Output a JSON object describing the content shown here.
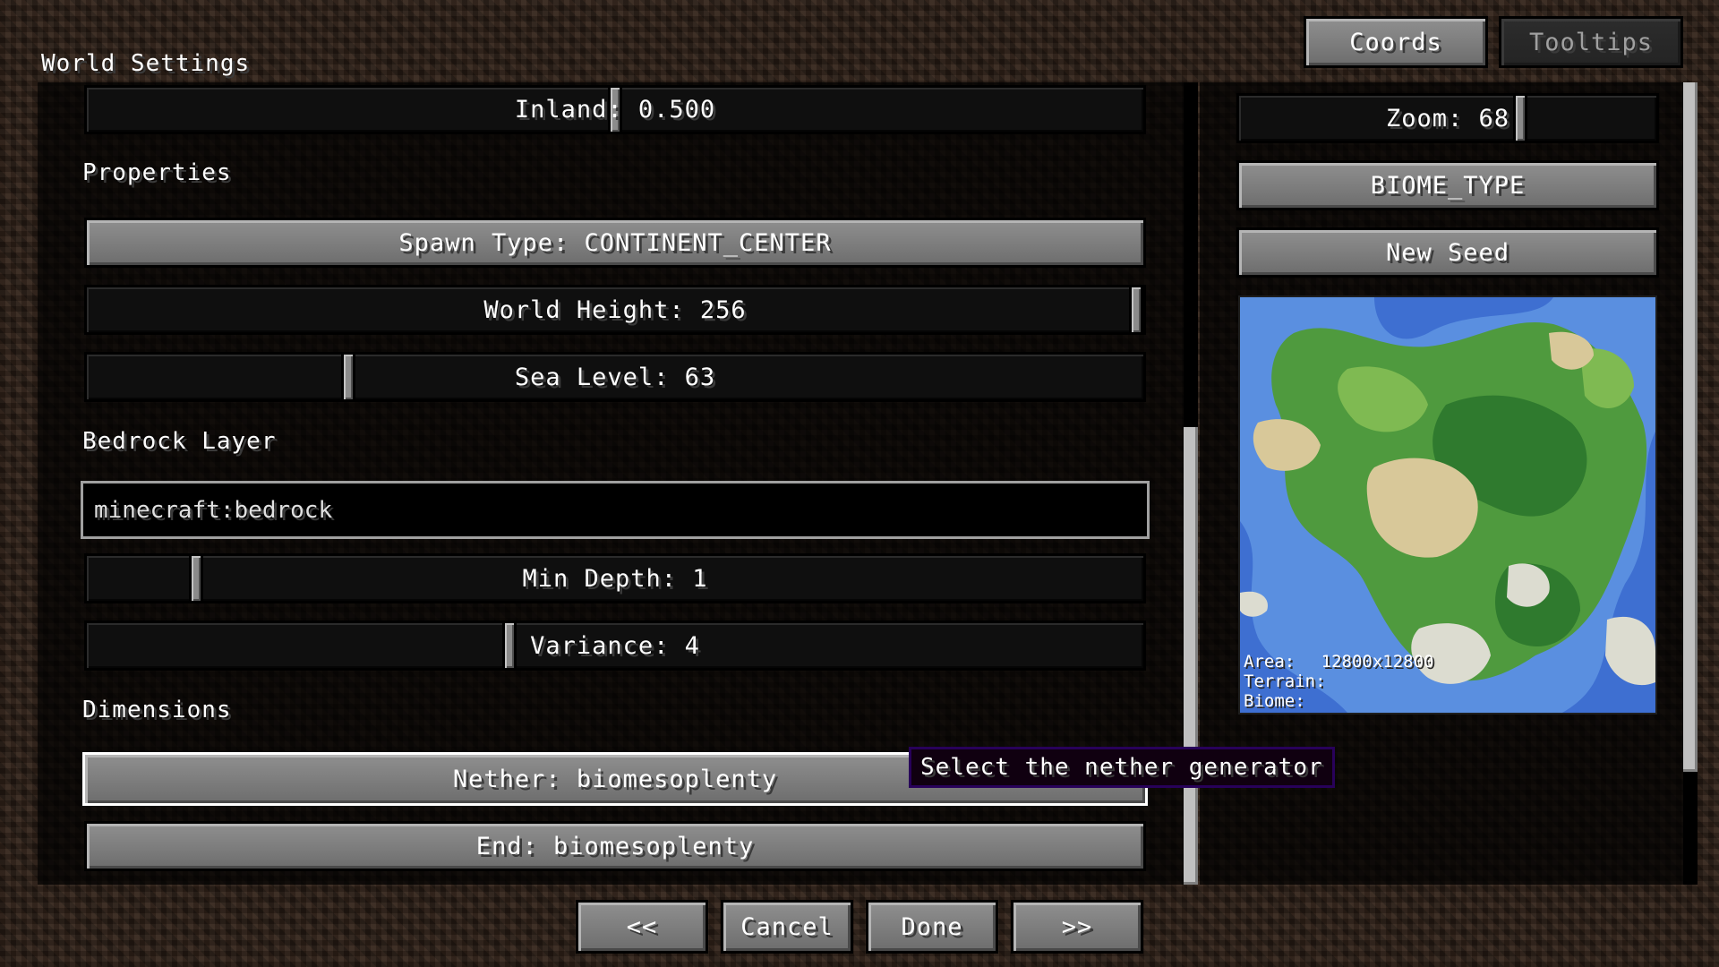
{
  "header": {
    "title": "World Settings"
  },
  "tabs": [
    {
      "label": "Coords",
      "active": true
    },
    {
      "label": "Tooltips",
      "active": false
    }
  ],
  "settings": {
    "inland": {
      "label": "Inland: 0.500",
      "value": 0.5
    },
    "properties_heading": "Properties",
    "spawn_type": "Spawn Type: CONTINENT_CENTER",
    "world_height": {
      "label": "World Height: 256",
      "value": 256
    },
    "sea_level": {
      "label": "Sea Level: 63",
      "value": 63
    },
    "bedrock_heading": "Bedrock Layer",
    "bedrock_block": "minecraft:bedrock",
    "min_depth": {
      "label": "Min Depth: 1",
      "value": 1
    },
    "variance": {
      "label": "Variance: 4",
      "value": 4
    },
    "dimensions_heading": "Dimensions",
    "nether": "Nether: biomesoplenty",
    "end": "End: biomesoplenty",
    "nether_tooltip": "Select the nether generator"
  },
  "preview": {
    "zoom": {
      "label": "Zoom: 68",
      "value": 68
    },
    "mode_button": "BIOME_TYPE",
    "new_seed_button": "New Seed",
    "info": {
      "area_label": "Area:",
      "area_value": "12800x12800",
      "terrain_label": "Terrain:",
      "biome_label": "Biome:"
    },
    "colors": {
      "ocean": "#3e6fd1",
      "shallow": "#5a8fe0",
      "forest": "#4f9a3e",
      "jungle": "#2f7a2e",
      "plains": "#7fba52",
      "desert": "#d8c899",
      "snow": "#dcdcd0"
    }
  },
  "footer": {
    "prev": "<<",
    "cancel": "Cancel",
    "done": "Done",
    "next": ">>"
  }
}
